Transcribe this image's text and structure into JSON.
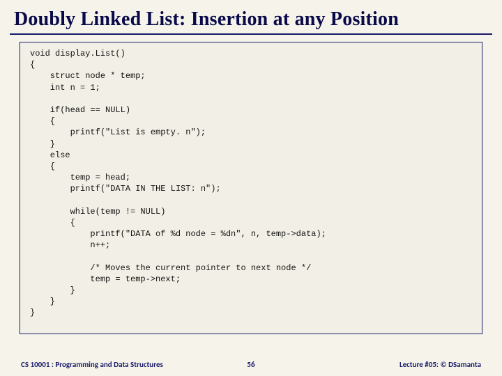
{
  "title": "Doubly Linked List: Insertion at any Position",
  "code": "void display.List()\n{\n    struct node * temp;\n    int n = 1;\n\n    if(head == NULL)\n    {\n        printf(\"List is empty. n\");\n    }\n    else\n    {\n        temp = head;\n        printf(\"DATA IN THE LIST: n\");\n\n        while(temp != NULL)\n        {\n            printf(\"DATA of %d node = %dn\", n, temp->data);\n            n++;\n\n            /* Moves the current pointer to next node */\n            temp = temp->next;\n        }\n    }\n}",
  "footer": {
    "left": "CS 10001 : Programming and Data Structures",
    "center": "56",
    "right": "Lecture #05: © DSamanta"
  }
}
